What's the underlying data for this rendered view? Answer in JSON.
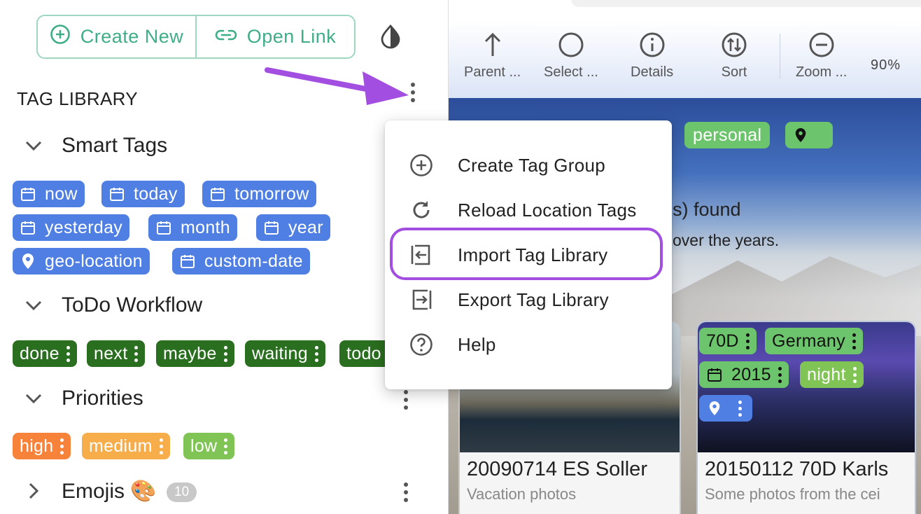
{
  "header": {
    "create_new_label": "Create New",
    "open_link_label": "Open Link"
  },
  "tag_library": {
    "title": "TAG LIBRARY",
    "groups": [
      {
        "name": "Smart Tags",
        "expanded": true,
        "tags": [
          {
            "label": "now",
            "icon": "calendar-icon",
            "color": "#4f7fe3"
          },
          {
            "label": "today",
            "icon": "calendar-icon",
            "color": "#4f7fe3"
          },
          {
            "label": "tomorrow",
            "icon": "calendar-icon",
            "color": "#4f7fe3"
          },
          {
            "label": "yesterday",
            "icon": "calendar-icon",
            "color": "#4f7fe3"
          },
          {
            "label": "month",
            "icon": "calendar-icon",
            "color": "#4f7fe3"
          },
          {
            "label": "year",
            "icon": "calendar-icon",
            "color": "#4f7fe3"
          },
          {
            "label": "geo-location",
            "icon": "location-pin-icon",
            "color": "#4f7fe3"
          },
          {
            "label": "custom-date",
            "icon": "calendar-icon",
            "color": "#4f7fe3"
          }
        ]
      },
      {
        "name": "ToDo Workflow",
        "expanded": true,
        "tags": [
          {
            "label": "done",
            "color": "#2a6e1f"
          },
          {
            "label": "next",
            "color": "#2a6e1f"
          },
          {
            "label": "maybe",
            "color": "#2a6e1f"
          },
          {
            "label": "waiting",
            "color": "#2a6e1f"
          },
          {
            "label": "todo",
            "color": "#2a6e1f"
          }
        ]
      },
      {
        "name": "Priorities",
        "expanded": true,
        "tags": [
          {
            "label": "high",
            "color": "#f7833a"
          },
          {
            "label": "medium",
            "color": "#f7ad4a"
          },
          {
            "label": "low",
            "color": "#7fc455"
          }
        ]
      },
      {
        "name": "Emojis 🎨",
        "expanded": false,
        "count": "10"
      }
    ]
  },
  "toolbar": {
    "items": [
      {
        "label": "Parent ...",
        "icon": "arrow-up-icon"
      },
      {
        "label": "Select ...",
        "icon": "circle-select-icon"
      },
      {
        "label": "Details",
        "icon": "info-icon"
      },
      {
        "label": "Sort",
        "icon": "sort-icon"
      },
      {
        "label": "Zoom ...",
        "icon": "zoom-out-icon"
      }
    ],
    "zoom_level": "90%"
  },
  "content": {
    "tags": [
      {
        "label": "personal",
        "color": "#6cc46c"
      },
      {
        "label": "",
        "icon": "location-pin-icon",
        "color": "#6cc46c"
      }
    ],
    "found_text": "s) found",
    "subtitle_text": "over the years.",
    "cards": [
      {
        "title": "20090714 ES Soller",
        "description": "Vacation photos"
      },
      {
        "title": "20150112 70D Karls",
        "description": "Some photos from the cei",
        "tags": [
          {
            "label": "70D",
            "color": "#6cc46c"
          },
          {
            "label": "Germany",
            "color": "#6cc46c"
          },
          {
            "label": "2015",
            "icon": "calendar-icon",
            "color": "#6cc46c"
          },
          {
            "label": "night",
            "color": "#7fc455"
          },
          {
            "label": "",
            "icon": "location-pin-icon",
            "color": "#4f7fe3"
          }
        ]
      }
    ]
  },
  "context_menu": {
    "items": [
      {
        "label": "Create Tag Group",
        "icon": "add-circle-icon"
      },
      {
        "label": "Reload Location Tags",
        "icon": "refresh-icon"
      },
      {
        "label": "Import Tag Library",
        "icon": "import-icon",
        "highlighted": true
      },
      {
        "label": "Export Tag Library",
        "icon": "export-icon"
      },
      {
        "label": "Help",
        "icon": "help-icon"
      }
    ]
  },
  "colors": {
    "accent": "#3fae87",
    "highlight": "#a24ee0",
    "smart_tag": "#4f7fe3",
    "workflow_tag": "#2a6e1f"
  }
}
